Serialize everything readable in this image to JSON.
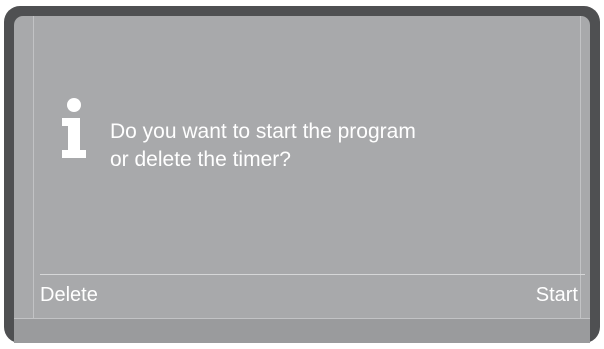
{
  "dialog": {
    "icon": "info-icon",
    "message_lines": [
      "Do you want to start the program",
      "or delete the timer?"
    ]
  },
  "softkeys": {
    "left_label": "Delete",
    "right_label": "Start"
  },
  "colors": {
    "frame": "#4f5052",
    "screen": "#a8a9ab",
    "text": "#ffffff"
  }
}
